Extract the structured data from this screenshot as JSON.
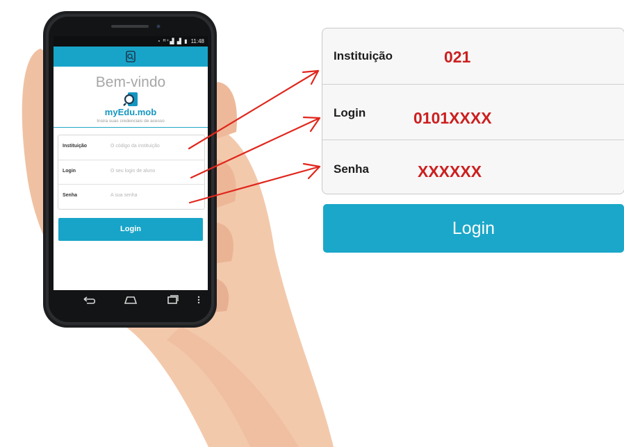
{
  "phone": {
    "status_time": "11:48",
    "welcome": "Bem-vindo",
    "app_name": "myEdu.mob",
    "subtitle": "Insira suas credenciais de acesso",
    "fields": [
      {
        "label": "Instituição",
        "placeholder": "O código da instituição"
      },
      {
        "label": "Login",
        "placeholder": "O seu login de aluno"
      },
      {
        "label": "Senha",
        "placeholder": "A sua senha"
      }
    ],
    "login_label": "Login"
  },
  "detail": {
    "fields": [
      {
        "label": "Instituição",
        "value": "021"
      },
      {
        "label": "Login",
        "value": "0101XXXX"
      },
      {
        "label": "Senha",
        "value": "XXXXXX"
      }
    ],
    "login_label": "Login"
  },
  "colors": {
    "accent": "#18a4c8",
    "value_red": "#cc1f1f",
    "arrow_red": "#e0261c"
  }
}
